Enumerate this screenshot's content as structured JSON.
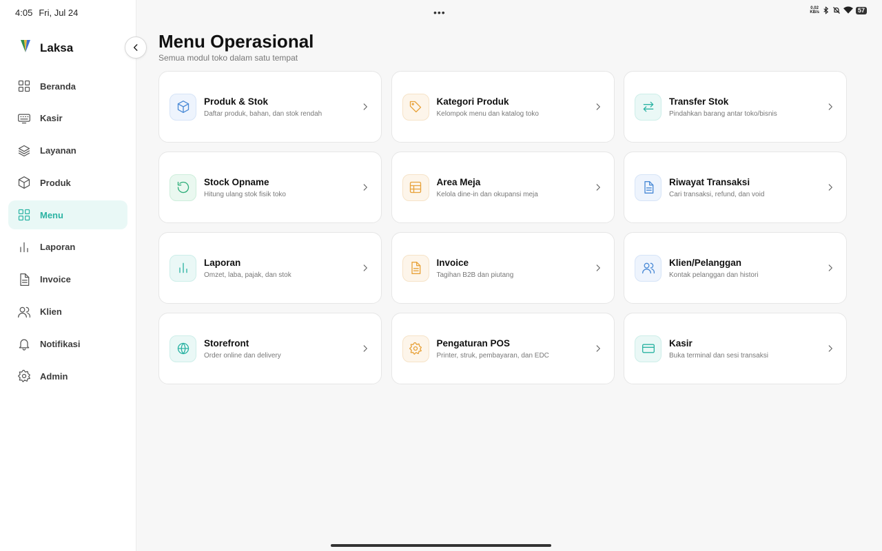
{
  "status_bar": {
    "time": "4:05",
    "date": "Fri, Jul 24",
    "speed_top": "0.02",
    "speed_bottom": "KB/s",
    "battery": "57"
  },
  "brand": {
    "name": "Laksa"
  },
  "sidebar": {
    "items": [
      {
        "label": "Beranda",
        "icon": "grid-icon",
        "active": false
      },
      {
        "label": "Kasir",
        "icon": "keyboard-icon",
        "active": false
      },
      {
        "label": "Layanan",
        "icon": "layers-icon",
        "active": false
      },
      {
        "label": "Produk",
        "icon": "box-icon",
        "active": false
      },
      {
        "label": "Menu",
        "icon": "grid-icon",
        "active": true
      },
      {
        "label": "Laporan",
        "icon": "bar-chart-icon",
        "active": false
      },
      {
        "label": "Invoice",
        "icon": "document-icon",
        "active": false
      },
      {
        "label": "Klien",
        "icon": "users-icon",
        "active": false
      },
      {
        "label": "Notifikasi",
        "icon": "bell-icon",
        "active": false
      },
      {
        "label": "Admin",
        "icon": "gear-icon",
        "active": false
      }
    ]
  },
  "main": {
    "title": "Menu Operasional",
    "subtitle": "Semua modul toko dalam satu tempat",
    "cards": [
      {
        "title": "Produk & Stok",
        "desc": "Daftar produk, bahan, dan stok rendah",
        "icon": "box-icon",
        "tone": "blue"
      },
      {
        "title": "Kategori Produk",
        "desc": "Kelompok menu dan katalog toko",
        "icon": "tag-icon",
        "tone": "orange"
      },
      {
        "title": "Transfer Stok",
        "desc": "Pindahkan barang antar toko/bisnis",
        "icon": "transfer-icon",
        "tone": "teal"
      },
      {
        "title": "Stock Opname",
        "desc": "Hitung ulang stok fisik toko",
        "icon": "refresh-icon",
        "tone": "green"
      },
      {
        "title": "Area Meja",
        "desc": "Kelola dine-in dan okupansi meja",
        "icon": "table-icon",
        "tone": "orange"
      },
      {
        "title": "Riwayat Transaksi",
        "desc": "Cari transaksi, refund, dan void",
        "icon": "document-icon",
        "tone": "blue"
      },
      {
        "title": "Laporan",
        "desc": "Omzet, laba, pajak, dan stok",
        "icon": "bar-chart-icon",
        "tone": "teal"
      },
      {
        "title": "Invoice",
        "desc": "Tagihan B2B dan piutang",
        "icon": "document-icon",
        "tone": "orange"
      },
      {
        "title": "Klien/Pelanggan",
        "desc": "Kontak pelanggan dan histori",
        "icon": "users-icon",
        "tone": "blue"
      },
      {
        "title": "Storefront",
        "desc": "Order online dan delivery",
        "icon": "globe-icon",
        "tone": "teal"
      },
      {
        "title": "Pengaturan POS",
        "desc": "Printer, struk, pembayaran, dan EDC",
        "icon": "gear-icon",
        "tone": "orange"
      },
      {
        "title": "Kasir",
        "desc": "Buka terminal dan sesi transaksi",
        "icon": "card-icon",
        "tone": "teal"
      }
    ]
  },
  "colors": {
    "accent": "#2bb3a3",
    "blue": "#4a8ad6",
    "orange": "#e8a23a",
    "teal": "#2bb3a3",
    "green": "#2fae7a"
  }
}
